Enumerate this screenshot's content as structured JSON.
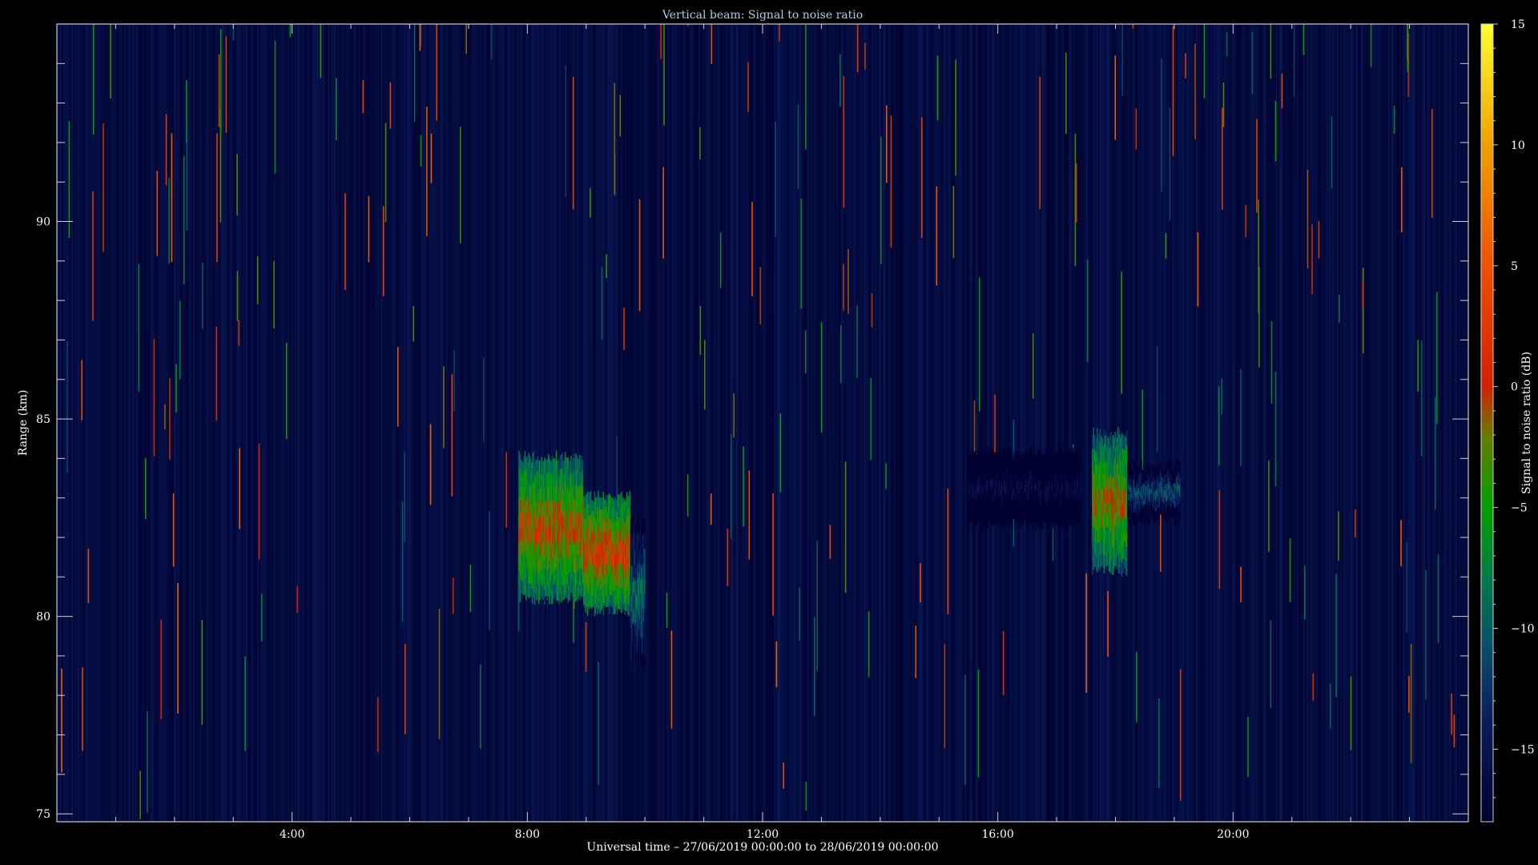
{
  "chart_data": {
    "type": "heatmap",
    "title": "Vertical beam: Signal to noise ratio",
    "xlabel": "Universal time – 27/06/2019 00:00:00 to 28/06/2019 00:00:00",
    "ylabel": "Range (km)",
    "colorbar_label": "Signal to noise ratio (dB)",
    "xlim": [
      0,
      24
    ],
    "ylim": [
      74.8,
      95
    ],
    "clim": [
      -18,
      15
    ],
    "x_ticks": [
      {
        "value": 4,
        "label": "4:00"
      },
      {
        "value": 8,
        "label": "8:00"
      },
      {
        "value": 12,
        "label": "12:00"
      },
      {
        "value": 16,
        "label": "16:00"
      },
      {
        "value": 20,
        "label": "20:00"
      }
    ],
    "y_ticks": [
      {
        "value": 75,
        "label": "75"
      },
      {
        "value": 80,
        "label": "80"
      },
      {
        "value": 85,
        "label": "85"
      },
      {
        "value": 90,
        "label": "90"
      }
    ],
    "colorbar_ticks": [
      {
        "value": 15,
        "label": "15"
      },
      {
        "value": 10,
        "label": "10"
      },
      {
        "value": 5,
        "label": "5"
      },
      {
        "value": 0,
        "label": "0"
      },
      {
        "value": -5,
        "label": "−5"
      },
      {
        "value": -10,
        "label": "−10"
      },
      {
        "value": -15,
        "label": "−15"
      }
    ],
    "colormap": [
      {
        "value": -18,
        "color": "#000030"
      },
      {
        "value": -14,
        "color": "#0a1a5a"
      },
      {
        "value": -11,
        "color": "#0a4a6a"
      },
      {
        "value": -8,
        "color": "#007a4a"
      },
      {
        "value": -5,
        "color": "#00a000"
      },
      {
        "value": -2,
        "color": "#6a7a00"
      },
      {
        "value": 0,
        "color": "#d02000"
      },
      {
        "value": 5,
        "color": "#f05000"
      },
      {
        "value": 10,
        "color": "#f0a000"
      },
      {
        "value": 15,
        "color": "#ffff30"
      }
    ],
    "background_snr": -16,
    "echo_regions": [
      {
        "t_start": 7.85,
        "t_end": 8.95,
        "r_low": 80.3,
        "r_high": 84.2,
        "snr_peak": 3
      },
      {
        "t_start": 8.95,
        "t_end": 9.75,
        "r_low": 80.0,
        "r_high": 83.2,
        "snr_peak": 4
      },
      {
        "t_start": 9.75,
        "t_end": 10.0,
        "r_low": 78.5,
        "r_high": 82.5,
        "snr_peak": -6
      },
      {
        "t_start": 15.5,
        "t_end": 17.4,
        "r_low": 82.2,
        "r_high": 84.3,
        "snr_peak": -13
      },
      {
        "t_start": 17.6,
        "t_end": 18.2,
        "r_low": 81.0,
        "r_high": 84.8,
        "snr_peak": 2
      },
      {
        "t_start": 18.2,
        "t_end": 19.1,
        "r_low": 82.3,
        "r_high": 84.0,
        "snr_peak": -8
      }
    ],
    "grid": false,
    "colorbar_position": "right"
  }
}
